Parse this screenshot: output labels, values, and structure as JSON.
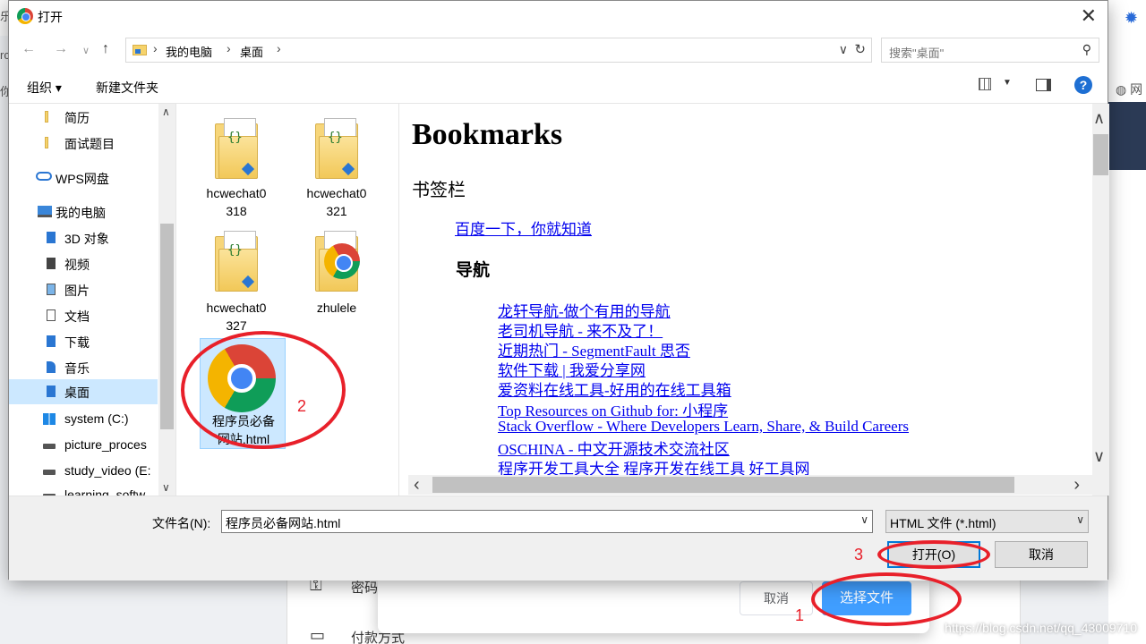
{
  "background": {
    "left_chars": [
      "乐",
      "rc",
      "你"
    ],
    "right_label": "网",
    "cancel_label": "取消",
    "choose_label": "选择文件",
    "row_labels": [
      "密码",
      "付款方式"
    ],
    "watermark": "https://blog.csdn.net/qq_43009710"
  },
  "dialog": {
    "title": "打开",
    "address": {
      "crumbs": [
        "我的电脑",
        "桌面"
      ],
      "search_placeholder": "搜索\"桌面\""
    },
    "toolbar": {
      "organize": "组织 ▾",
      "new_folder": "新建文件夹",
      "help": "?"
    },
    "nav_items": [
      {
        "label": "简历",
        "icon": "folder-icon"
      },
      {
        "label": "面试题目",
        "icon": "folder-icon"
      },
      {
        "label": "WPS网盘",
        "icon": "cloud-icon"
      },
      {
        "label": "我的电脑",
        "icon": "computer-icon"
      },
      {
        "label": "3D 对象",
        "icon": "3d-objects-icon"
      },
      {
        "label": "视频",
        "icon": "video-icon"
      },
      {
        "label": "图片",
        "icon": "pictures-icon"
      },
      {
        "label": "文档",
        "icon": "documents-icon"
      },
      {
        "label": "下载",
        "icon": "downloads-icon"
      },
      {
        "label": "音乐",
        "icon": "music-icon"
      },
      {
        "label": "桌面",
        "icon": "desktop-icon"
      },
      {
        "label": "system (C:)",
        "icon": "drive-icon"
      },
      {
        "label": "picture_proces",
        "icon": "drive-icon"
      },
      {
        "label": "study_video (E:",
        "icon": "drive-icon"
      },
      {
        "label": "learning_softw",
        "icon": "drive-icon"
      }
    ],
    "files": [
      {
        "name_line1": "hcwechat0",
        "name_line2": "318"
      },
      {
        "name_line1": "hcwechat0",
        "name_line2": "321"
      },
      {
        "name_line1": "hcwechat0",
        "name_line2": "327"
      },
      {
        "name_line1": "zhulele",
        "name_line2": ""
      },
      {
        "name_line1": "程序员必备",
        "name_line2": "网站.html"
      }
    ],
    "preview": {
      "h1": "Bookmarks",
      "section": "书签栏",
      "top_link": "百度一下，你就知道",
      "subsection": "导航",
      "links": [
        "龙轩导航-做个有用的导航",
        "老司机导航 - 来不及了！",
        "近期热门 - SegmentFault 思否",
        "软件下载 | 我爱分享网",
        "爱资料在线工具-好用的在线工具箱",
        "Top Resources on Github for: 小程序",
        "Stack Overflow - Where Developers Learn, Share, & Build Careers",
        "OSCHINA - 中文开源技术交流社区",
        "程序开发工具大全 程序开发在线工具 好工具网"
      ]
    },
    "bottom": {
      "filename_label": "文件名(N):",
      "filename_value": "程序员必备网站.html",
      "filetype": "HTML 文件 (*.html)",
      "open_label": "打开(O)",
      "cancel_label": "取消"
    }
  },
  "annotations": [
    "1",
    "2",
    "3"
  ],
  "colors": {
    "annotation": "#e8202a",
    "selection": "#cce8ff",
    "link": "#0000ee",
    "primary_button": "#409eff"
  }
}
